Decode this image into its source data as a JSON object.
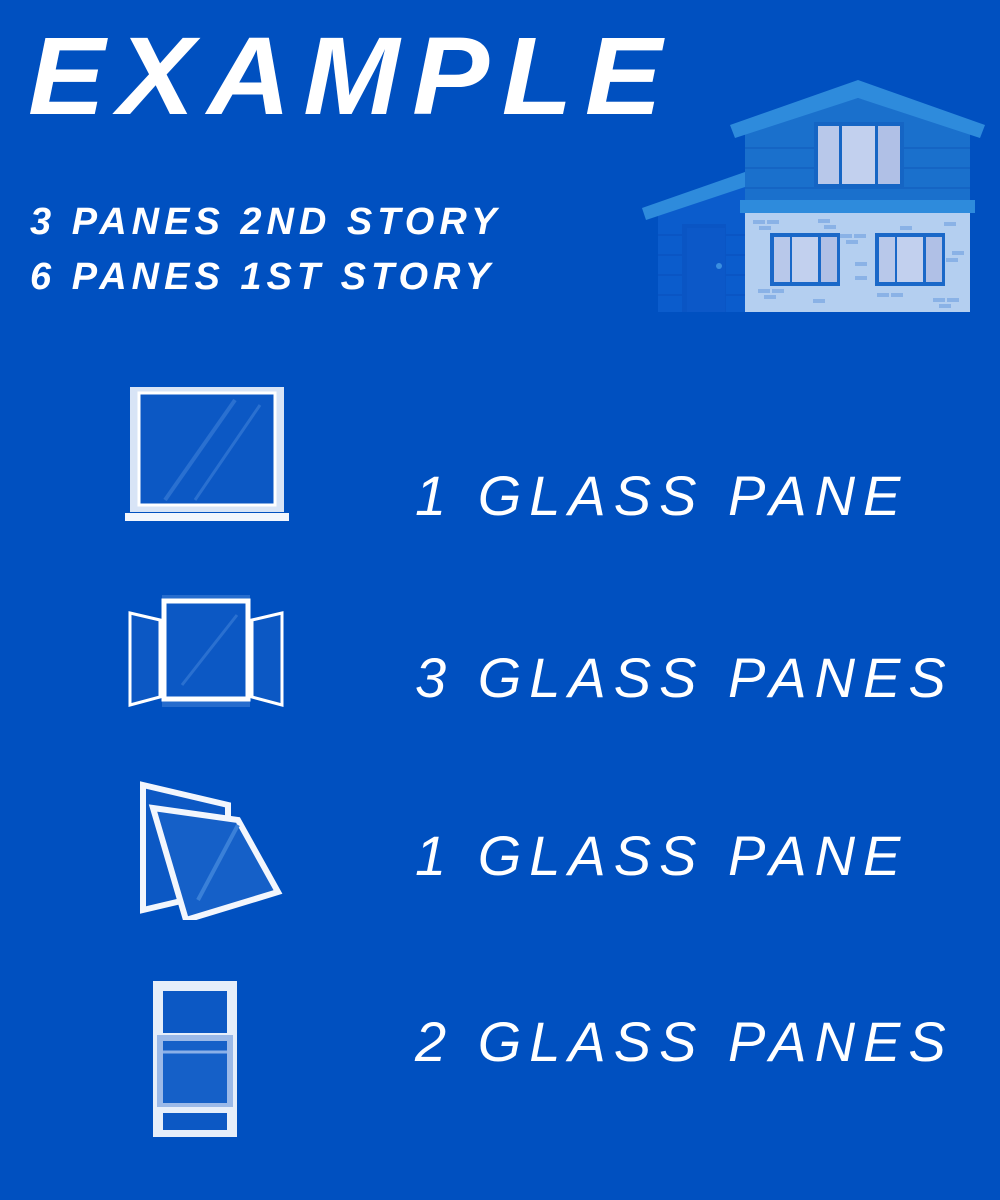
{
  "title": "EXAMPLE",
  "example_lines": [
    "3 PANES 2ND STORY",
    "6 PANES 1ST STORY"
  ],
  "windows": [
    {
      "icon": "picture-window-icon",
      "label": "1 GLASS PANE"
    },
    {
      "icon": "bay-window-icon",
      "label": "3 GLASS PANES"
    },
    {
      "icon": "awning-window-icon",
      "label": "1 GLASS PANE"
    },
    {
      "icon": "double-hung-window-icon",
      "label": "2 GLASS PANES"
    }
  ],
  "colors": {
    "background": "#0050c0",
    "text": "#ffffff"
  }
}
